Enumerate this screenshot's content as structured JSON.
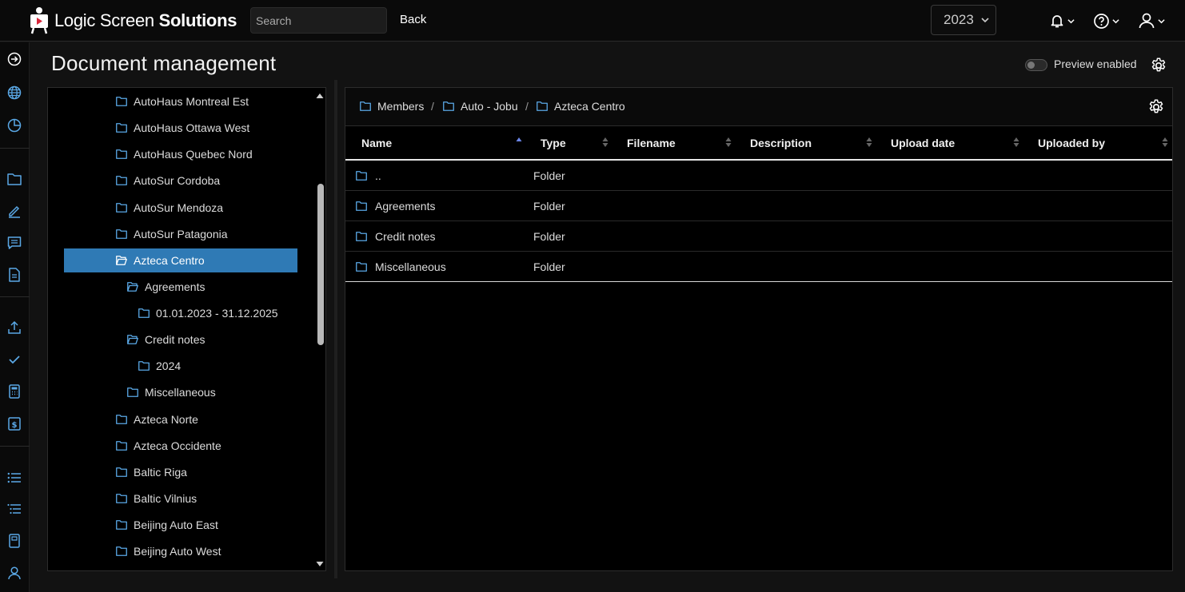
{
  "app": {
    "logo_light": "Logic Screen",
    "logo_bold": "Solutions",
    "search_placeholder": "Search",
    "back_label": "Back",
    "year": "2023"
  },
  "page": {
    "title": "Document management",
    "preview_label": "Preview enabled"
  },
  "tree": {
    "items": [
      {
        "label": "AutoHaus Montreal Est"
      },
      {
        "label": "AutoHaus Ottawa West"
      },
      {
        "label": "AutoHaus Quebec Nord"
      },
      {
        "label": "AutoSur Cordoba"
      },
      {
        "label": "AutoSur Mendoza"
      },
      {
        "label": "AutoSur Patagonia"
      },
      {
        "label": "Azteca Centro"
      },
      {
        "label": "Agreements"
      },
      {
        "label": "01.01.2023 - 31.12.2025"
      },
      {
        "label": "Credit notes"
      },
      {
        "label": "2024"
      },
      {
        "label": "Miscellaneous"
      },
      {
        "label": "Azteca Norte"
      },
      {
        "label": "Azteca Occidente"
      },
      {
        "label": "Baltic Riga"
      },
      {
        "label": "Baltic Vilnius"
      },
      {
        "label": "Beijing Auto East"
      },
      {
        "label": "Beijing Auto West"
      }
    ]
  },
  "breadcrumb": [
    "Members",
    "Auto - Jobu",
    "Azteca Centro"
  ],
  "breadcrumb_separator": "/",
  "table": {
    "columns": [
      "Name",
      "Type",
      "Filename",
      "Description",
      "Upload date",
      "Uploaded by"
    ],
    "rows": [
      {
        "name": "..",
        "type": "Folder"
      },
      {
        "name": "Agreements",
        "type": "Folder"
      },
      {
        "name": "Credit notes",
        "type": "Folder"
      },
      {
        "name": "Miscellaneous",
        "type": "Folder"
      }
    ]
  },
  "colors": {
    "accent": "#2f7ab5",
    "folder_icon": "#5aa8e6",
    "background": "#000000"
  }
}
